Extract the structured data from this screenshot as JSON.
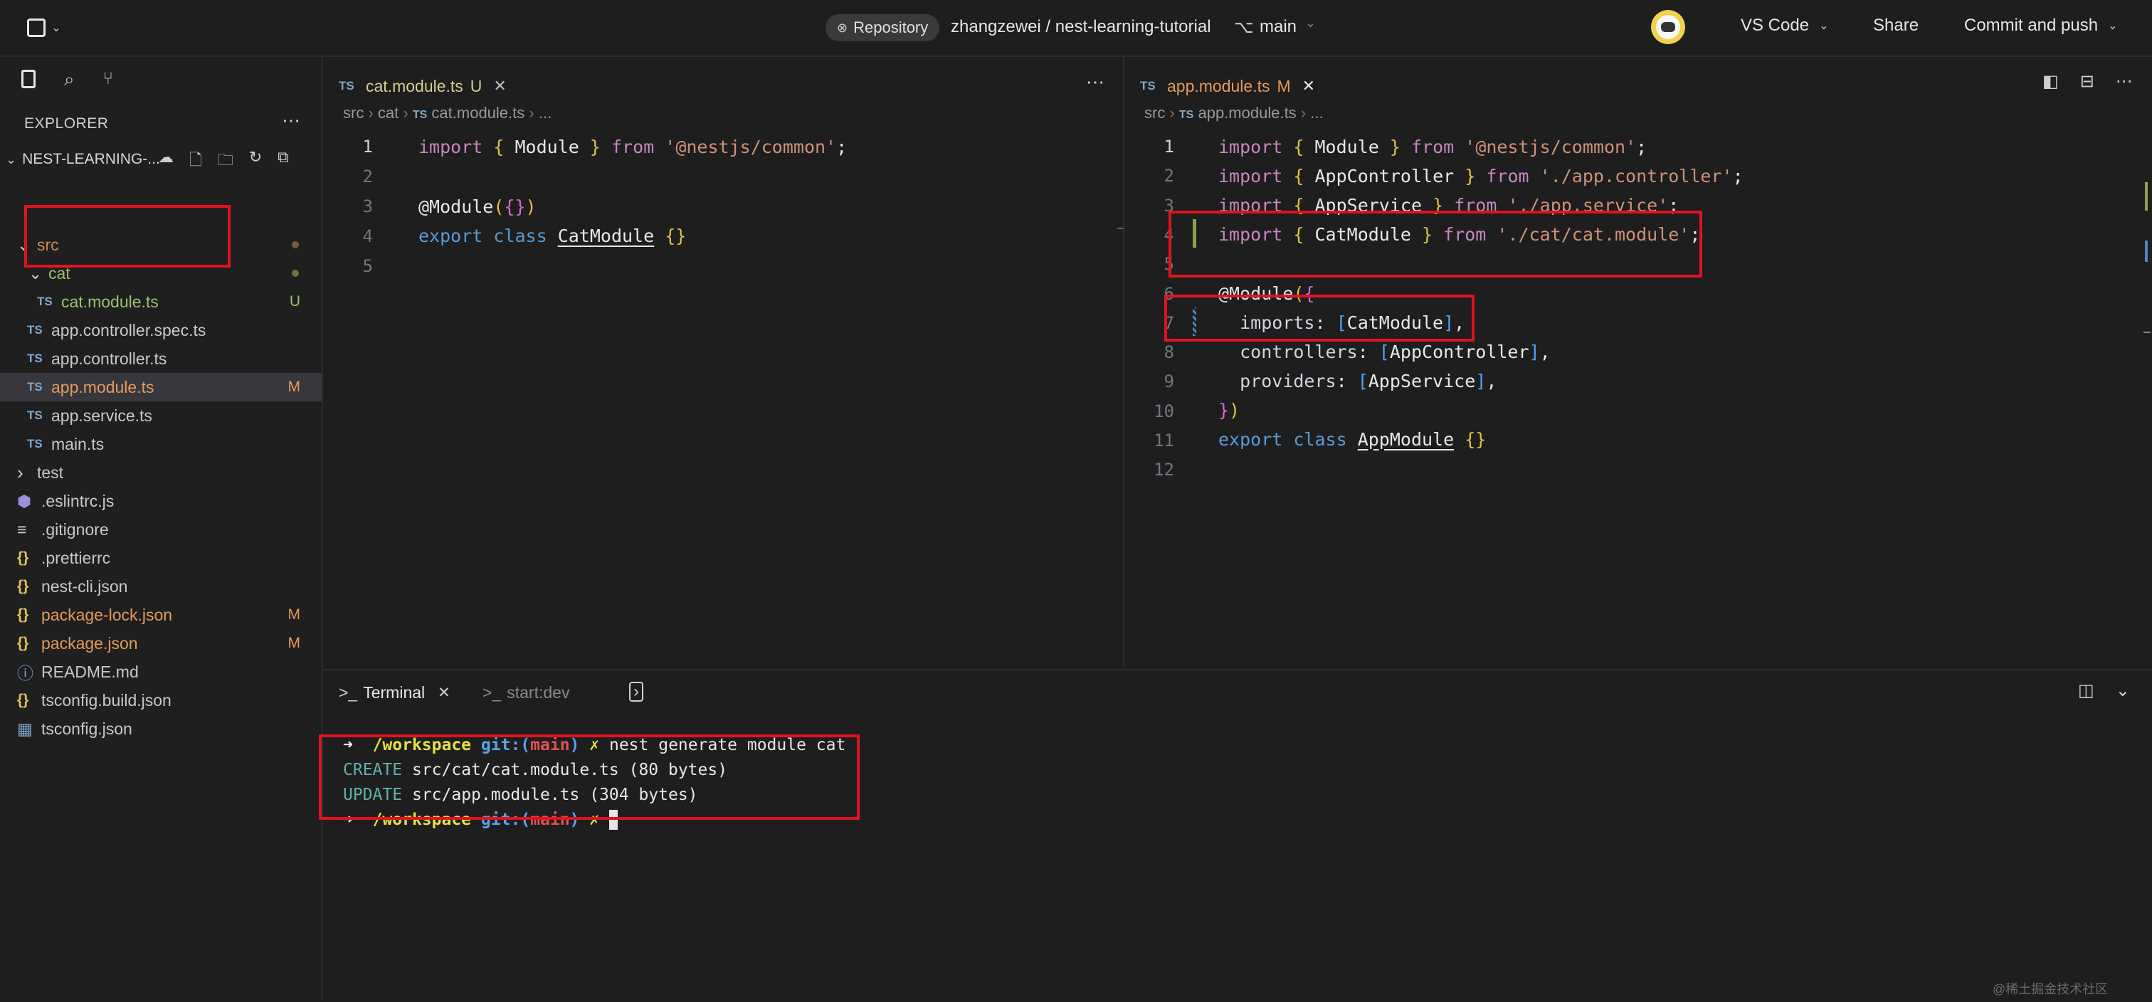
{
  "topbar": {
    "repo_badge": "Repository",
    "repo_path": "zhangzewei / nest-learning-tutorial",
    "branch": "main",
    "vscode_label": "VS Code",
    "share_label": "Share",
    "commit_label": "Commit and push"
  },
  "explorer": {
    "title": "EXPLORER",
    "project": "NEST-LEARNING-...",
    "items": [
      {
        "label": "src",
        "badge": "",
        "kind": "folder-open"
      },
      {
        "label": "cat",
        "badge": "",
        "kind": "folder-open"
      },
      {
        "label": "cat.module.ts",
        "badge": "U",
        "kind": "ts"
      },
      {
        "label": "app.controller.spec.ts",
        "badge": "",
        "kind": "ts"
      },
      {
        "label": "app.controller.ts",
        "badge": "",
        "kind": "ts"
      },
      {
        "label": "app.module.ts",
        "badge": "M",
        "kind": "ts"
      },
      {
        "label": "app.service.ts",
        "badge": "",
        "kind": "ts"
      },
      {
        "label": "main.ts",
        "badge": "",
        "kind": "ts"
      },
      {
        "label": "test",
        "badge": "",
        "kind": "folder"
      },
      {
        "label": ".eslintrc.js",
        "badge": "",
        "kind": "eslint"
      },
      {
        "label": ".gitignore",
        "badge": "",
        "kind": "lines"
      },
      {
        "label": ".prettierrc",
        "badge": "",
        "kind": "json"
      },
      {
        "label": "nest-cli.json",
        "badge": "",
        "kind": "json"
      },
      {
        "label": "package-lock.json",
        "badge": "M",
        "kind": "json"
      },
      {
        "label": "package.json",
        "badge": "M",
        "kind": "json"
      },
      {
        "label": "README.md",
        "badge": "",
        "kind": "info"
      },
      {
        "label": "tsconfig.build.json",
        "badge": "",
        "kind": "json"
      },
      {
        "label": "tsconfig.json",
        "badge": "",
        "kind": "tsconfig"
      }
    ]
  },
  "left_editor": {
    "tab_label": "cat.module.ts",
    "tab_status": "U",
    "breadcrumb": [
      "src",
      "cat",
      "cat.module.ts",
      "..."
    ],
    "line_numbers": [
      "1",
      "2",
      "3",
      "4",
      "5"
    ],
    "tokens": {
      "l1_import": "import",
      "l1_open": "{",
      "l1_id": "Module",
      "l1_close": "}",
      "l1_from": "from",
      "l1_str": "'@nestjs/common'",
      "l1_semi": ";",
      "l3_dec": "@Module",
      "l3_p1": "(",
      "l3_obj": "{}",
      "l3_p2": ")",
      "l4_export": "export",
      "l4_class": "class",
      "l4_name": "CatModule",
      "l4_body": "{}"
    }
  },
  "right_editor": {
    "tab_label": "app.module.ts",
    "tab_status": "M",
    "breadcrumb": [
      "src",
      "app.module.ts",
      "..."
    ],
    "line_numbers": [
      "1",
      "2",
      "3",
      "4",
      "5",
      "6",
      "7",
      "8",
      "9",
      "10",
      "11",
      "12"
    ],
    "tokens": {
      "import": "import",
      "from": "from",
      "l1_id": "Module",
      "l1_str": "'@nestjs/common'",
      "l2_id": "AppController",
      "l2_str": "'./app.controller'",
      "l3_id": "AppService",
      "l3_str": "'./app.service'",
      "l4_id": "CatModule",
      "l4_str": "'./cat/cat.module'",
      "l6_dec": "@Module",
      "l7_key": "imports",
      "l7_val": "CatModule",
      "l8_key": "controllers",
      "l8_val": "AppController",
      "l9_key": "providers",
      "l9_val": "AppService",
      "l11_export": "export",
      "l11_class": "class",
      "l11_name": "AppModule",
      "l11_body": "{}"
    }
  },
  "terminal": {
    "tab_terminal": "Terminal",
    "tab_start": "start:dev",
    "prompt_arrow": "➜",
    "prompt_dir": "/workspace",
    "prompt_git": "git:(",
    "prompt_branch": "main",
    "prompt_git_close": ")",
    "prompt_x": "✗",
    "command": "nest generate module cat",
    "create_word": "CREATE",
    "create_rest": "src/cat/cat.module.ts (80 bytes)",
    "update_word": "UPDATE",
    "update_rest": "src/app.module.ts (304 bytes)"
  },
  "watermark": "@稀土掘金技术社区"
}
